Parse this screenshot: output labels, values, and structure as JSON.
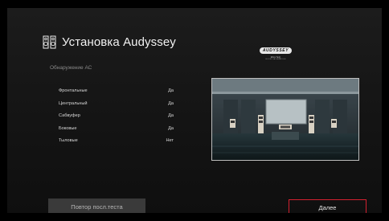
{
  "header": {
    "title": "Установка Audyssey",
    "subtitle": "Обнаружение АС",
    "icon": "speaker-pair-icon"
  },
  "logo": {
    "brand": "AUDYSSEY",
    "line1": "MULTEQ",
    "line2": "ROOM CALIBRATION"
  },
  "speakers": [
    {
      "name": "Фронтальные",
      "status": "Да"
    },
    {
      "name": "Центральный",
      "status": "Да"
    },
    {
      "name": "Сабвуфер",
      "status": "Да"
    },
    {
      "name": "Боковые",
      "status": "Да"
    },
    {
      "name": "Тыловые",
      "status": "Нет"
    }
  ],
  "buttons": {
    "retest": "Повтор посл.теста",
    "next": "Далее"
  },
  "colors": {
    "accent_border": "#d2202f",
    "background": "#151515"
  }
}
